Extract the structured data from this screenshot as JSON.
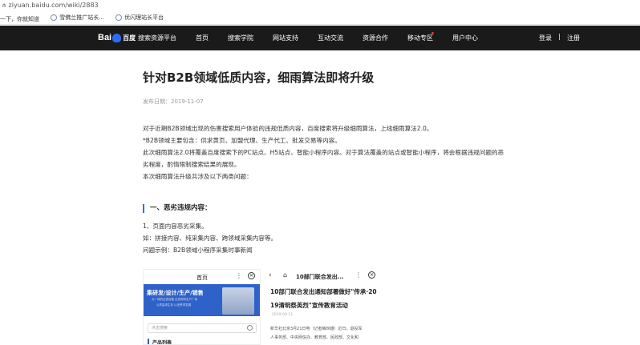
{
  "browser": {
    "url": "ziyuan.baidu.com/wiki/2883",
    "bookmarks": [
      "一下，你就知道",
      "雪佛兰推广站长...",
      "优闪理站长平台"
    ]
  },
  "nav": {
    "logo_text_bai": "Bai",
    "logo_text_du": "百度",
    "brand_sub": "搜索资源平台",
    "menu": [
      "首页",
      "搜索学院",
      "网站支持",
      "互动交流",
      "资源合作",
      "移动专区",
      "用户中心"
    ],
    "login": "登录",
    "separator": "|",
    "register": "注册"
  },
  "article": {
    "title": "针对B2B领域低质内容，细雨算法即将升级",
    "date": "发布日期：2019-11-07",
    "paragraphs": [
      "对于近期B2B领域出现的伤害搜索用户体验的违规低质内容，百度搜索将升级细雨算法，上线细雨算法2.0。",
      "*B2B领域主要包含：供求黄页、加盟代理、生产代工、批发交易等内容。",
      "此次细雨算法2.0将覆盖百度搜索下的PC站点、H5站点、智能小程序内容。对于算法覆盖的站点或智能小程序，将会根据违规问题的恶",
      "劣程度，酌情限制搜索结果的展现。",
      "本次细雨算法升级共涉及以下两类问题："
    ],
    "section_heading": "一、恶劣违规内容：",
    "section_lines": [
      "1、页面内容恶劣采集。",
      "如：拼接内容、纯采集内容、跨领域采集内容等。",
      "问题示例：B2B领域小程序采集时事新闻"
    ]
  },
  "example1": {
    "top_title": "首页",
    "more": "⋮",
    "close": "✕",
    "banner_title": "集研发/设计/生产/销售",
    "banner_line1": "为一体的过滤设备 过滤材料生产厂商",
    "banner_line2": "以质量求生存 以信誉求发展",
    "search_placeholder": "点击搜索",
    "category": "产品列表"
  },
  "example2": {
    "back": "‹",
    "home": "⌂",
    "top_title": "10部门联合发出...",
    "more": "⋮",
    "close": "✕",
    "headline1": "10部门联合发出通知部署做好\"传承·20",
    "headline2": "19清明祭英烈\"宣传教育活动",
    "date": "2019-04-11",
    "body1": "新华社北京3月21日电（记者梅世雄）近日，退役军",
    "body2": "人事务部、中央网信办、教育部、民政部、文化和"
  }
}
